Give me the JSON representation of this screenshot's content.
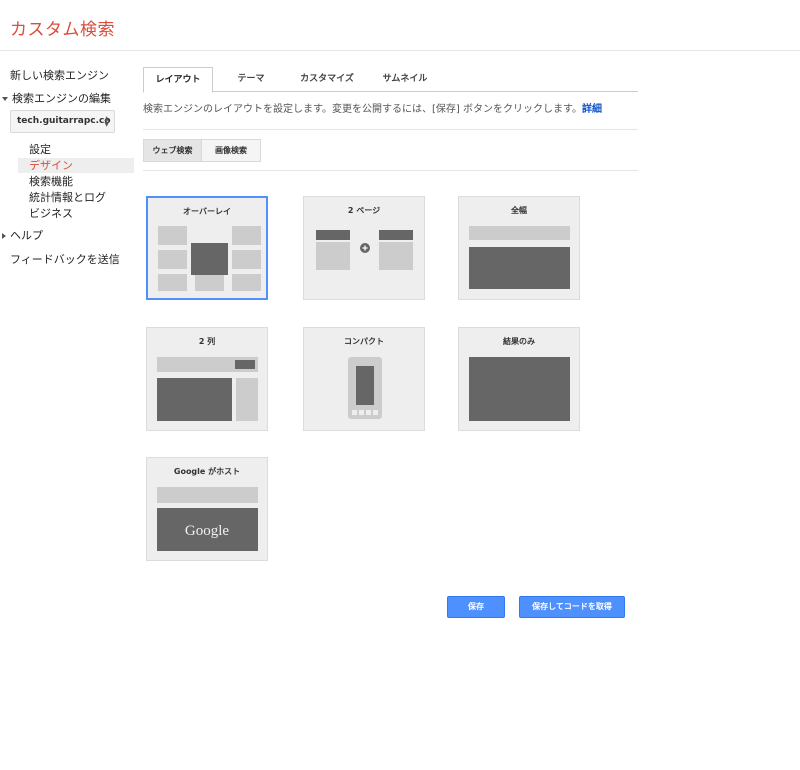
{
  "app": {
    "title": "カスタム検索"
  },
  "sidebar": {
    "new_engine": "新しい検索エンジン",
    "edit_engine": "検索エンジンの編集",
    "engine_select_value": "tech.guitarrapc.co",
    "sub_items": [
      "設定",
      "デザイン",
      "検索機能",
      "統計情報とログ",
      "ビジネス"
    ],
    "active_sub_item": "デザイン",
    "help": "ヘルプ",
    "feedback": "フィードバックを送信"
  },
  "tabs": [
    "レイアウト",
    "テーマ",
    "カスタマイズ",
    "サムネイル"
  ],
  "active_tab": "レイアウト",
  "description": {
    "text": "検索エンジンのレイアウトを設定します。変更を公開するには、[保存] ボタンをクリックします。",
    "link": "詳細"
  },
  "search_type": [
    "ウェブ検索",
    "画像検索"
  ],
  "active_search_type": "ウェブ検索",
  "layouts": [
    {
      "id": "overlay",
      "label": "オーバーレイ",
      "selected": true
    },
    {
      "id": "two-page",
      "label": "2 ページ",
      "selected": false
    },
    {
      "id": "full-width",
      "label": "全幅",
      "selected": false
    },
    {
      "id": "two-column",
      "label": "2 列",
      "selected": false
    },
    {
      "id": "compact",
      "label": "コンパクト",
      "selected": false
    },
    {
      "id": "results-only",
      "label": "結果のみ",
      "selected": false
    },
    {
      "id": "google-hosted",
      "label": "Google がホスト",
      "selected": false,
      "logo_text": "Google"
    }
  ],
  "buttons": {
    "save": "保存",
    "save_get_code": "保存してコードを取得"
  },
  "colors": {
    "accent": "#dd4b39",
    "primary_button": "#4d90fe",
    "link": "#1155cc",
    "selection_border": "#4d90fe"
  }
}
